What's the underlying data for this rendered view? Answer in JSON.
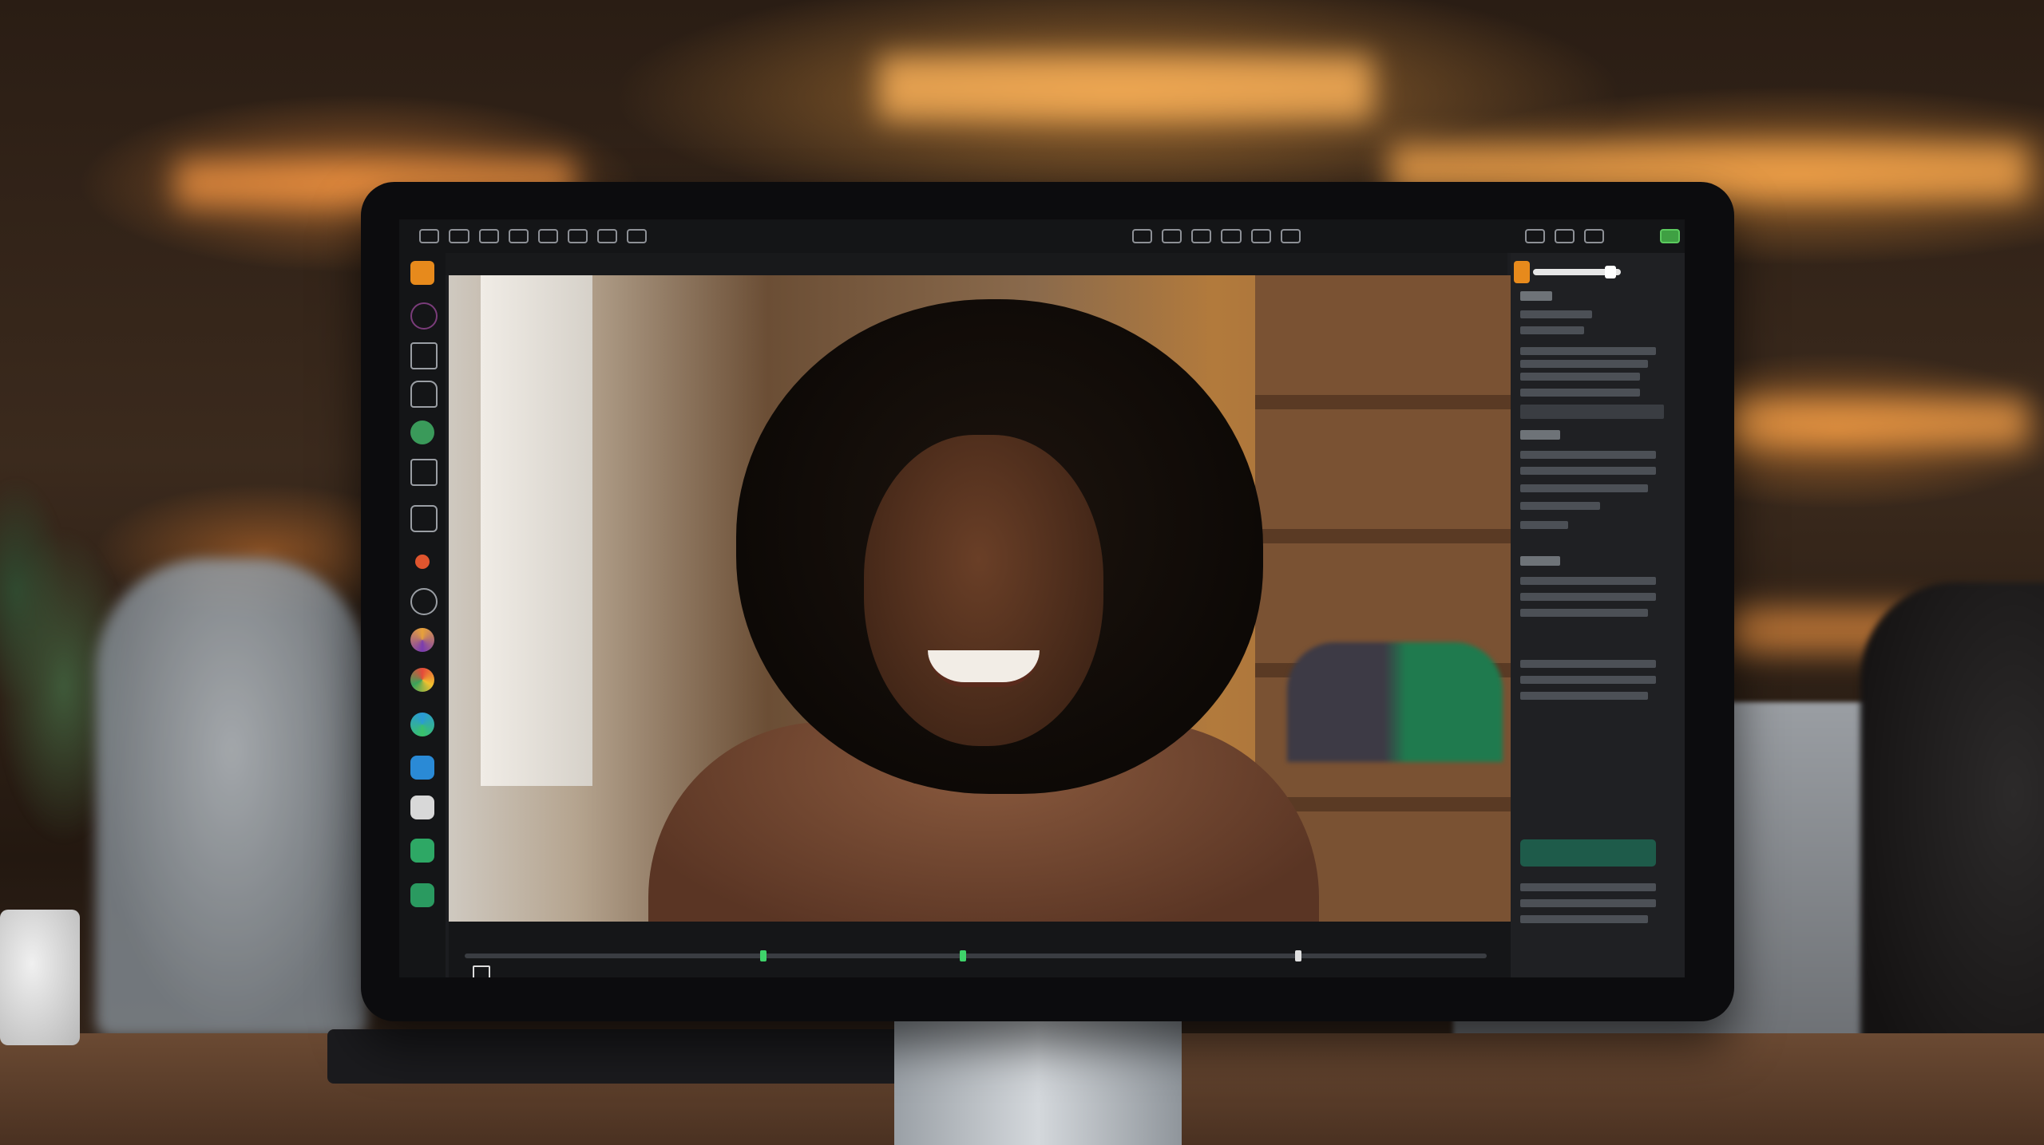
{
  "scene": {
    "description_type": "photo of a computer monitor in a cafe showing a video-editing application with a smiling woman in the preview",
    "accent_colors": {
      "warm_light": "#f2a54a",
      "green_panel": "#1e5b4a",
      "orange_app_icon": "#e78a1c"
    }
  },
  "app": {
    "left_toolbar_icons": [
      "home-icon",
      "circle-icon",
      "crop-icon",
      "headphones-icon",
      "brush-icon",
      "text-icon",
      "subtitles-icon",
      "record-icon",
      "settings-icon",
      "browser-icon",
      "chrome-icon",
      "edge-icon",
      "app-icon",
      "app-icon",
      "document-icon",
      "phone-icon"
    ],
    "top_toolbar_icons": [
      "menu-icon",
      "pause-icon",
      "undo-icon",
      "shield-icon",
      "info-icon",
      "layout-icon",
      "columns-icon",
      "chat-icon",
      "search-icon",
      "settings-icon",
      "share-icon",
      "layers-icon",
      "audio-icon",
      "help-icon"
    ],
    "right_panel": {
      "progress": 0.75
    }
  }
}
